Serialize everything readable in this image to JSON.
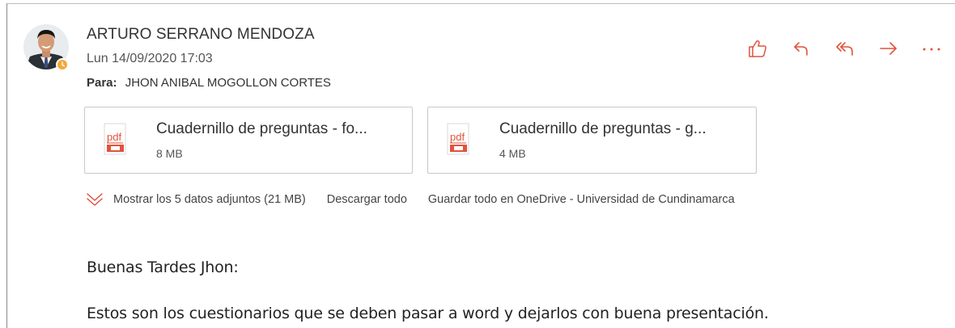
{
  "message": {
    "sender_name": "ARTURO SERRANO MENDOZA",
    "sent_datetime": "Lun 14/09/2020 17:03",
    "to_label": "Para:",
    "to_name": "JHON ANIBAL MOGOLLON CORTES",
    "presence_status": "away",
    "actions": [
      {
        "name": "like-icon"
      },
      {
        "name": "reply-icon"
      },
      {
        "name": "reply-all-icon"
      },
      {
        "name": "forward-icon"
      },
      {
        "name": "more-actions-icon"
      }
    ],
    "accent_color": "#e0533d"
  },
  "attachments": {
    "items": [
      {
        "icon": "pdf-file-icon",
        "icon_text": "pdf",
        "name": "Cuadernillo de preguntas - fo...",
        "size": "8 MB"
      },
      {
        "icon": "pdf-file-icon",
        "icon_text": "pdf",
        "name": "Cuadernillo de preguntas - g...",
        "size": "4 MB"
      }
    ],
    "show_all_label": "Mostrar los 5 datos adjuntos (21 MB)",
    "download_all_label": "Descargar todo",
    "save_onedrive_label": "Guardar todo en OneDrive - Universidad de Cundinamarca"
  },
  "body": {
    "greeting": "Buenas Tardes Jhon:",
    "paragraph": "Estos son los cuestionarios que se deben pasar a word y dejarlos con buena presentación."
  }
}
